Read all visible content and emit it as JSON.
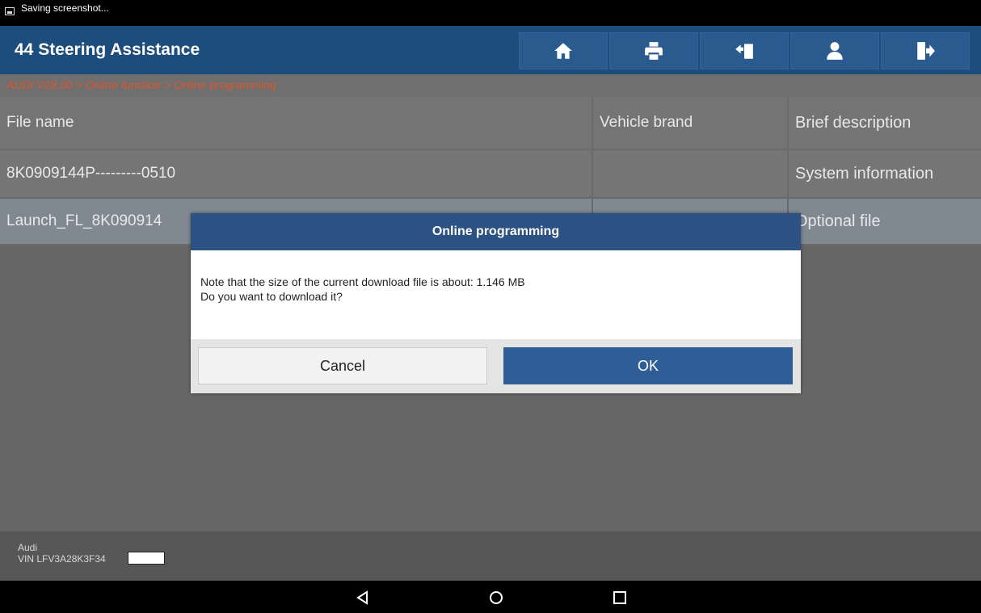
{
  "status_bar": {
    "text": "Saving screenshot..."
  },
  "header": {
    "title": "44 Steering Assistance",
    "toolbar": [
      {
        "icon": "home-icon"
      },
      {
        "icon": "print-icon"
      },
      {
        "icon": "report-icon"
      },
      {
        "icon": "user-icon"
      },
      {
        "icon": "exit-icon"
      }
    ]
  },
  "breadcrumb": "AUDI V28.00 > Online function > Online programming",
  "table": {
    "columns": [
      "File name",
      "Vehicle brand",
      "Brief description"
    ],
    "rows": [
      [
        "8K0909144P---------0510",
        "",
        "System information"
      ],
      [
        "Launch_FL_8K090914",
        "",
        "Optional file"
      ]
    ]
  },
  "dialog": {
    "title": "Online programming",
    "message_line1": "Note that the size of the current download file is about: 1.146 MB",
    "message_line2": "Do you want to download it?",
    "cancel_label": "Cancel",
    "ok_label": "OK"
  },
  "footer": {
    "brand": "Audi",
    "vin": "VIN LFV3A28K3F34"
  },
  "colors": {
    "header_bg": "#1d4d7d",
    "breadcrumb_text": "#d9572f",
    "dialog_title_bg": "#2b5282",
    "ok_button_bg": "#2f5e96"
  }
}
